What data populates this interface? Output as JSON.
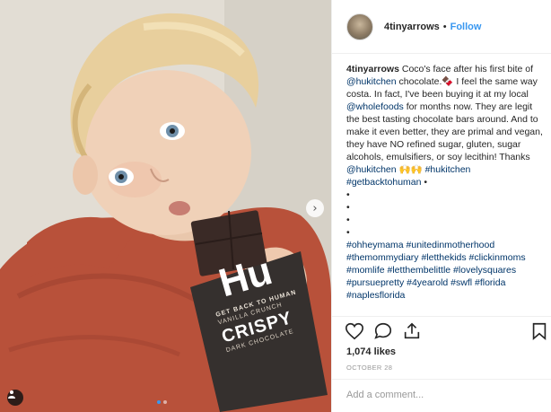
{
  "post": {
    "username": "4tinyarrows",
    "follow_label": "Follow",
    "separator": "•",
    "caption_text": "Coco's face after his first bite of ",
    "mention_1": "@hukitchen",
    "caption_text_2": " chocolate.🍫 I feel the same way costa. In fact, I've been buying it at my local ",
    "mention_2": "@wholefoods",
    "caption_text_3": " for months now. They are legit the best tasting chocolate bars around. And to make it even better, they are primal and vegan, they have NO refined sugar, gluten, sugar alcohols, emulsifiers, or soy lecithin! Thanks ",
    "mention_3": "@hukitchen",
    "caption_text_4": " 🙌🙌 ",
    "hashtag_1": "#hukitchen",
    "hashtag_2": "#getbacktohuman",
    "bullet": "•",
    "hashtags_block": "#ohheymama #unitedinmotherhood #themommydiary #letthekids #clickinmoms #momlife #letthembelittle #lovelysquares #pursuepretty #4yearold #swfl #florida #naplesflorida",
    "likes": "1,074 likes",
    "date": "OCTOBER 28",
    "comment_placeholder": "Add a comment...",
    "carousel_dots": 2
  },
  "product": {
    "brand_mark": "Hu",
    "tagline": "GET BACK TO HUMAN",
    "flavor": "VANILLA CRUNCH",
    "name": "CRISPY",
    "kind": "DARK CHOCOLATE"
  },
  "icons": {
    "next": "chevron-right-icon",
    "tag": "person-tag-icon",
    "like": "heart-icon",
    "comment": "comment-icon",
    "share": "share-icon",
    "save": "bookmark-icon"
  },
  "colors": {
    "link": "#003569",
    "follow": "#3897f0",
    "shirt": "#b8513a"
  }
}
